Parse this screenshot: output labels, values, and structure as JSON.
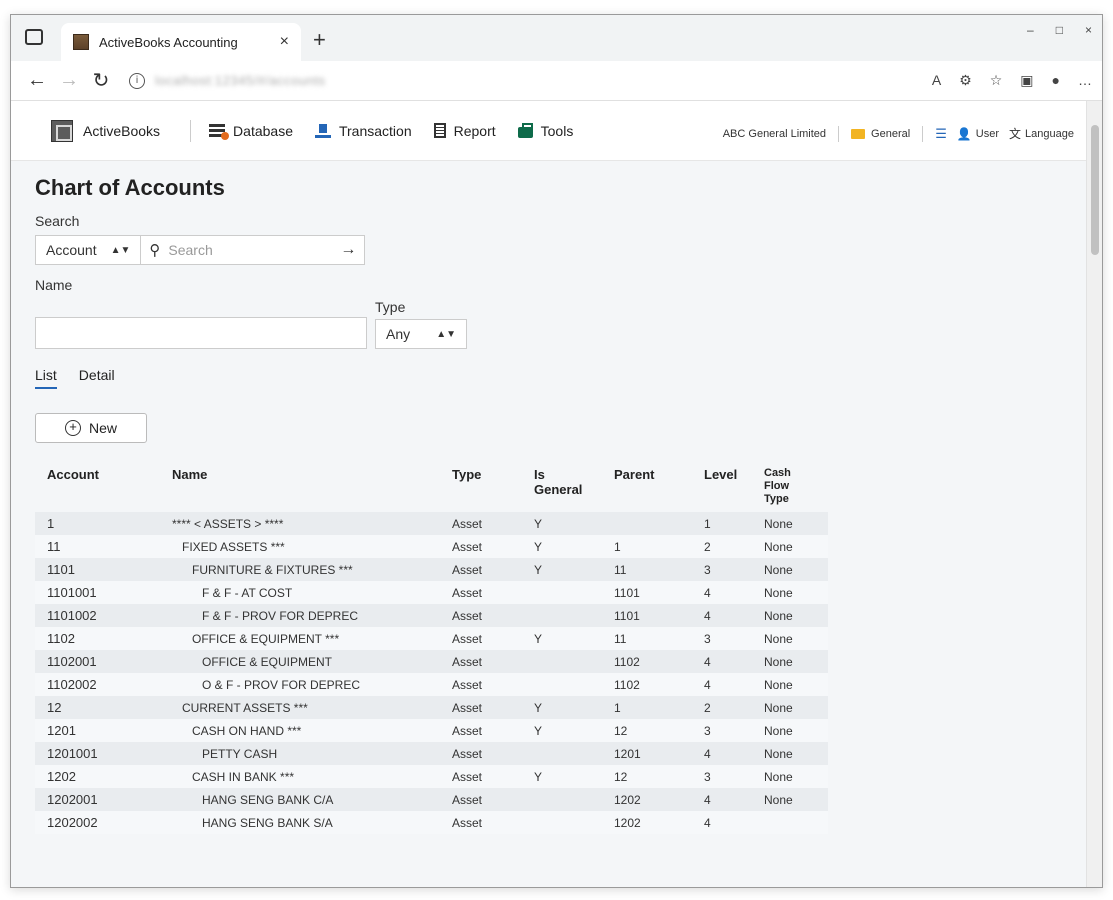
{
  "browser": {
    "tab_title": "ActiveBooks Accounting",
    "tab_close": "×",
    "new_tab": "+",
    "url": "localhost:12345/#/accounts"
  },
  "app": {
    "brand": "ActiveBooks",
    "nav": {
      "database": "Database",
      "transaction": "Transaction",
      "report": "Report",
      "tools": "Tools"
    },
    "company": "ABC General Limited",
    "section": "General",
    "user": "User",
    "language": "Language"
  },
  "page": {
    "title": "Chart of Accounts",
    "search_label": "Search",
    "search_field": "Account",
    "search_placeholder": "Search",
    "name_label": "Name",
    "type_label": "Type",
    "type_value": "Any",
    "tabs": [
      "List",
      "Detail"
    ],
    "new_button": "New"
  },
  "table": {
    "headers": [
      "Account",
      "Name",
      "Type",
      "Is General",
      "Parent",
      "Level",
      "Cash Flow Type"
    ],
    "rows": [
      {
        "account": "1",
        "name": "**** < ASSETS > ****",
        "indent": 0,
        "type": "Asset",
        "general": "Y",
        "parent": "",
        "level": "1",
        "cashflow": "None"
      },
      {
        "account": "11",
        "name": "FIXED ASSETS ***",
        "indent": 1,
        "type": "Asset",
        "general": "Y",
        "parent": "1",
        "level": "2",
        "cashflow": "None"
      },
      {
        "account": "1101",
        "name": "FURNITURE & FIXTURES ***",
        "indent": 2,
        "type": "Asset",
        "general": "Y",
        "parent": "11",
        "level": "3",
        "cashflow": "None"
      },
      {
        "account": "1101001",
        "name": "F & F - AT COST",
        "indent": 3,
        "type": "Asset",
        "general": "",
        "parent": "1101",
        "level": "4",
        "cashflow": "None"
      },
      {
        "account": "1101002",
        "name": "F & F - PROV FOR DEPREC",
        "indent": 3,
        "type": "Asset",
        "general": "",
        "parent": "1101",
        "level": "4",
        "cashflow": "None"
      },
      {
        "account": "1102",
        "name": "OFFICE & EQUIPMENT ***",
        "indent": 2,
        "type": "Asset",
        "general": "Y",
        "parent": "11",
        "level": "3",
        "cashflow": "None"
      },
      {
        "account": "1102001",
        "name": "OFFICE & EQUIPMENT",
        "indent": 3,
        "type": "Asset",
        "general": "",
        "parent": "1102",
        "level": "4",
        "cashflow": "None"
      },
      {
        "account": "1102002",
        "name": "O & F - PROV FOR DEPREC",
        "indent": 3,
        "type": "Asset",
        "general": "",
        "parent": "1102",
        "level": "4",
        "cashflow": "None"
      },
      {
        "account": "12",
        "name": "CURRENT ASSETS ***",
        "indent": 1,
        "type": "Asset",
        "general": "Y",
        "parent": "1",
        "level": "2",
        "cashflow": "None"
      },
      {
        "account": "1201",
        "name": "CASH ON HAND ***",
        "indent": 2,
        "type": "Asset",
        "general": "Y",
        "parent": "12",
        "level": "3",
        "cashflow": "None"
      },
      {
        "account": "1201001",
        "name": "PETTY CASH",
        "indent": 3,
        "type": "Asset",
        "general": "",
        "parent": "1201",
        "level": "4",
        "cashflow": "None"
      },
      {
        "account": "1202",
        "name": "CASH IN BANK ***",
        "indent": 2,
        "type": "Asset",
        "general": "Y",
        "parent": "12",
        "level": "3",
        "cashflow": "None"
      },
      {
        "account": "1202001",
        "name": "HANG SENG BANK C/A",
        "indent": 3,
        "type": "Asset",
        "general": "",
        "parent": "1202",
        "level": "4",
        "cashflow": "None"
      },
      {
        "account": "1202002",
        "name": "HANG SENG BANK S/A",
        "indent": 3,
        "type": "Asset",
        "general": "",
        "parent": "1202",
        "level": "4",
        "cashflow": ""
      }
    ]
  }
}
